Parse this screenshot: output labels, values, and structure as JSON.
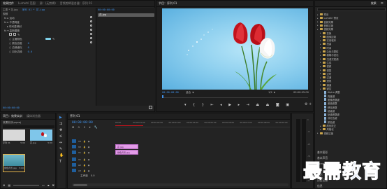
{
  "effect_controls": {
    "tabs": [
      "效果控件",
      "Lumetri 范围",
      "源：(无剪辑)",
      "音频剪辑混合器：序列 01"
    ],
    "master_label": "主要 * 花.jpg",
    "clip_label": "序列 01 * 花.jpg",
    "section_video": "视频",
    "fx_motion": "fx  ▸ 运动",
    "fx_opacity": "fx  ▸ 不透明度",
    "fx_time_remap": "▸ 时间重映射",
    "fx_blur_effect": "fx  ▾ 高斯模糊",
    "props": [
      {
        "label": "○ 蒙版",
        "value": ""
      },
      {
        "label": "○ 主要颜色",
        "value": ""
      },
      {
        "label": "○ 颜色容差",
        "value": "0"
      },
      {
        "label": "○ 边缘细化",
        "value": "0"
      },
      {
        "label": "○ 羽化边缘",
        "value": "0.0"
      }
    ],
    "clip_name": "花.jpg",
    "timecode": "00:00:00:00"
  },
  "program_monitor": {
    "title": "节目：序列 01",
    "timecode_left": "00:00:00:00",
    "fit_label": "适合",
    "quality": "1/2",
    "timecode_right": "00:00:05:00"
  },
  "effects_panel": {
    "tabs": [
      "效果"
    ],
    "search_placeholder": "",
    "items": [
      {
        "label": "预设",
        "kind": "folder",
        "indent": 0
      },
      {
        "label": "Lumetri 预设",
        "kind": "folder",
        "indent": 0
      },
      {
        "label": "音频效果",
        "kind": "folder",
        "indent": 0
      },
      {
        "label": "音频过渡",
        "kind": "folder",
        "indent": 0
      },
      {
        "label": "视频效果",
        "kind": "folder",
        "indent": 0
      },
      {
        "label": "变换",
        "kind": "folder",
        "indent": 1
      },
      {
        "label": "图像控制",
        "kind": "folder",
        "indent": 1
      },
      {
        "label": "实用程序",
        "kind": "folder",
        "indent": 1
      },
      {
        "label": "扭曲",
        "kind": "folder",
        "indent": 1
      },
      {
        "label": "时间",
        "kind": "folder",
        "indent": 1
      },
      {
        "label": "杂色与颗粒",
        "kind": "folder",
        "indent": 1
      },
      {
        "label": "模糊与锐化",
        "kind": "folder",
        "indent": 1
      },
      {
        "label": "沉浸式视频",
        "kind": "folder",
        "indent": 1
      },
      {
        "label": "生成",
        "kind": "folder",
        "indent": 1
      },
      {
        "label": "视频",
        "kind": "folder",
        "indent": 1
      },
      {
        "label": "调整",
        "kind": "folder",
        "indent": 1
      },
      {
        "label": "过时",
        "kind": "folder",
        "indent": 1
      },
      {
        "label": "过渡",
        "kind": "folder",
        "indent": 1
      },
      {
        "label": "透视",
        "kind": "folder",
        "indent": 1
      },
      {
        "label": "通道",
        "kind": "folder",
        "indent": 1
      },
      {
        "label": "键控",
        "kind": "folder",
        "indent": 1
      },
      {
        "label": "Alpha 调整",
        "kind": "file",
        "indent": 2
      },
      {
        "label": "亮度键",
        "kind": "file",
        "indent": 2
      },
      {
        "label": "图像遮罩键",
        "kind": "file",
        "indent": 2
      },
      {
        "label": "差值遮罩",
        "kind": "file",
        "indent": 2
      },
      {
        "label": "移除遮罩",
        "kind": "file",
        "indent": 2
      },
      {
        "label": "超级键",
        "kind": "file",
        "indent": 2
      },
      {
        "label": "轨道遮罩键",
        "kind": "file",
        "indent": 2
      },
      {
        "label": "非红色键",
        "kind": "file",
        "indent": 2
      },
      {
        "label": "颜色键",
        "kind": "file",
        "indent": 2
      },
      {
        "label": "颜色校正",
        "kind": "folder",
        "indent": 1
      },
      {
        "label": "风格化",
        "kind": "folder",
        "indent": 1
      },
      {
        "label": "视频过渡",
        "kind": "folder",
        "indent": 0
      }
    ],
    "bottom_items": [
      "基本图形",
      "基本声音",
      "Lumetri 颜色",
      "库",
      "标记",
      "历史记录",
      "信息"
    ]
  },
  "project_panel": {
    "tabs": [
      "项目：效果实训",
      "媒体浏览器"
    ],
    "project_file": "效果实训.prproj",
    "items": [
      {
        "name": "序列 01",
        "duration": "5:00"
      },
      {
        "name": "花.jpg",
        "duration": "5:00"
      },
      {
        "name": "绿色背景.jpg",
        "duration": "5:00"
      }
    ]
  },
  "timeline": {
    "tab": "序列 01",
    "timecode": "00:00:00:00",
    "ruler": [
      "00:00",
      "00:00:01:00",
      "00:00:02:00",
      "00:00:03:00",
      "00:00:04:00",
      "00:00:05:00",
      "00:00:06:00",
      "00:00:07:00",
      "00:00:08:00",
      "00:00:09:00"
    ],
    "tracks": [
      "V3",
      "V2",
      "V1",
      "A1",
      "A2",
      "A3"
    ],
    "master": "主声道",
    "master_value": "0.0",
    "clip_v2": "花.jpg",
    "clip_v1": "绿色背景.jpg"
  },
  "watermark": "最需教育",
  "colors": {
    "accent_blue": "#3f8fe6",
    "clip_pink": "#e39be8",
    "sky_blue": "#8fd0ef",
    "tulip_red": "#c3121b"
  }
}
